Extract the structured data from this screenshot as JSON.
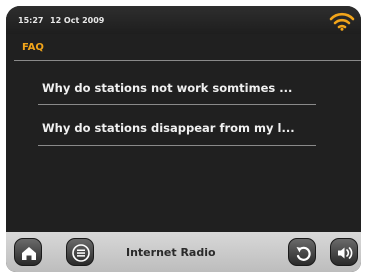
{
  "status": {
    "time": "15:27",
    "date": "12 Oct  2009",
    "wifi_icon": "wifi-signal-icon",
    "wifi_color": "#f2a51a"
  },
  "breadcrumb": "FAQ",
  "faq_items": [
    {
      "label": "Why do stations not work somtimes ..."
    },
    {
      "label": "Why do stations disappear from my l..."
    }
  ],
  "bottom_bar": {
    "title": "Internet Radio",
    "home_icon": "home-icon",
    "menu_icon": "menu-icon",
    "back_icon": "back-icon",
    "volume_icon": "volume-icon"
  }
}
